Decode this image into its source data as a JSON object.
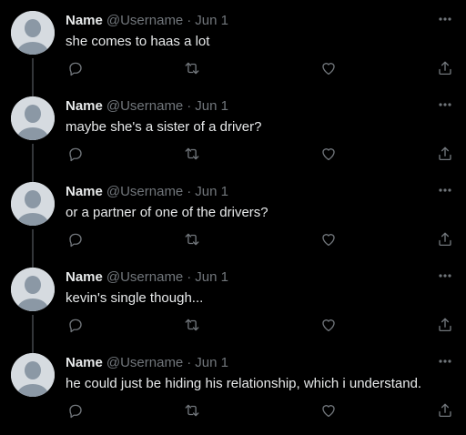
{
  "colors": {
    "background": "#000000",
    "text": "#e7e9ea",
    "secondary": "#71767b",
    "thread_line": "#333639",
    "avatar_bg": "#d6dbe0",
    "avatar_fg": "#8b98a5"
  },
  "icons": {
    "more": "more-horizontal-icon",
    "reply": "reply-icon",
    "retweet": "retweet-icon",
    "like": "heart-icon",
    "share": "share-icon"
  },
  "tweets": [
    {
      "name": "Name",
      "handle": "@Username",
      "separator": "·",
      "date": "Jun 1",
      "text": "she comes to haas a lot"
    },
    {
      "name": "Name",
      "handle": "@Username",
      "separator": "·",
      "date": "Jun 1",
      "text": "maybe she's a sister of a driver?"
    },
    {
      "name": "Name",
      "handle": "@Username",
      "separator": "·",
      "date": "Jun 1",
      "text": "or a partner of one of the drivers?"
    },
    {
      "name": "Name",
      "handle": "@Username",
      "separator": "·",
      "date": "Jun 1",
      "text": "kevin's single though..."
    },
    {
      "name": "Name",
      "handle": "@Username",
      "separator": "·",
      "date": "Jun 1",
      "text": "he could just be hiding his relationship, which i understand."
    }
  ]
}
